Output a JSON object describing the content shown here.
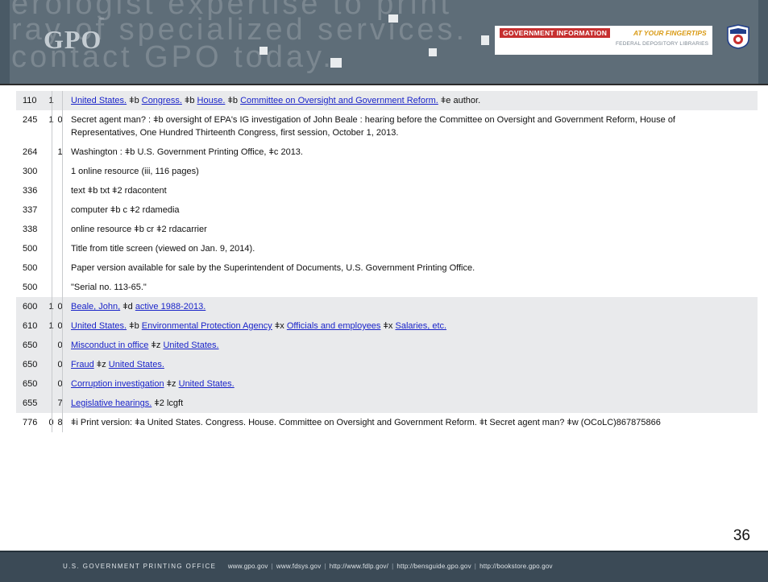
{
  "header": {
    "watermark_lines": [
      "erologist expertise to print",
      "ray of specialized services.",
      "contact GPO today."
    ],
    "logo_text": "GPO",
    "tagline_primary": "GOVERNMENT INFORMATION",
    "tagline_secondary": "AT YOUR FINGERTIPS",
    "tagline_sub": "FEDERAL DEPOSITORY LIBRARIES"
  },
  "record": {
    "rows": [
      {
        "tag": "110",
        "i1": "1",
        "i2": "",
        "shaded": true,
        "parts": [
          {
            "t": "United States.",
            "link": true
          },
          {
            "t": " ǂb "
          },
          {
            "t": "Congress.",
            "link": true
          },
          {
            "t": " ǂb "
          },
          {
            "t": "House.",
            "link": true
          },
          {
            "t": " ǂb "
          },
          {
            "t": "Committee on Oversight and Government Reform.",
            "link": true
          },
          {
            "t": " ǂe author."
          }
        ]
      },
      {
        "tag": "245",
        "i1": "1",
        "i2": "0",
        "shaded": false,
        "parts": [
          {
            "t": "Secret agent man? : ǂb oversight of EPA's IG investigation of John Beale : hearing before the Committee on Oversight and Government Reform, House of Representatives, One Hundred Thirteenth Congress, first session, October 1, 2013."
          }
        ]
      },
      {
        "tag": "264",
        "i1": "",
        "i2": "1",
        "shaded": false,
        "parts": [
          {
            "t": "Washington : ǂb U.S. Government Printing Office, ǂc 2013."
          }
        ]
      },
      {
        "tag": "300",
        "i1": "",
        "i2": "",
        "shaded": false,
        "parts": [
          {
            "t": "1 online resource (iii, 116 pages)"
          }
        ]
      },
      {
        "tag": "336",
        "i1": "",
        "i2": "",
        "shaded": false,
        "parts": [
          {
            "t": "text ǂb txt ǂ2 rdacontent"
          }
        ]
      },
      {
        "tag": "337",
        "i1": "",
        "i2": "",
        "shaded": false,
        "parts": [
          {
            "t": "computer ǂb c ǂ2 rdamedia"
          }
        ]
      },
      {
        "tag": "338",
        "i1": "",
        "i2": "",
        "shaded": false,
        "parts": [
          {
            "t": "online resource ǂb cr ǂ2 rdacarrier"
          }
        ]
      },
      {
        "tag": "500",
        "i1": "",
        "i2": "",
        "shaded": false,
        "parts": [
          {
            "t": "Title from title screen (viewed on Jan. 9, 2014)."
          }
        ]
      },
      {
        "tag": "500",
        "i1": "",
        "i2": "",
        "shaded": false,
        "parts": [
          {
            "t": "Paper version available for sale by the Superintendent of Documents, U.S. Government Printing Office."
          }
        ]
      },
      {
        "tag": "500",
        "i1": "",
        "i2": "",
        "shaded": false,
        "parts": [
          {
            "t": "\"Serial no. 113-65.\""
          }
        ]
      },
      {
        "tag": "600",
        "i1": "1",
        "i2": "0",
        "shaded": true,
        "parts": [
          {
            "t": "Beale, John,",
            "link": true
          },
          {
            "t": " ǂd "
          },
          {
            "t": "active 1988-2013.",
            "link": true
          }
        ]
      },
      {
        "tag": "610",
        "i1": "1",
        "i2": "0",
        "shaded": true,
        "parts": [
          {
            "t": "United States.",
            "link": true
          },
          {
            "t": " ǂb "
          },
          {
            "t": "Environmental Protection Agency",
            "link": true
          },
          {
            "t": " ǂx "
          },
          {
            "t": "Officials and employees",
            "link": true
          },
          {
            "t": " ǂx "
          },
          {
            "t": "Salaries, etc.",
            "link": true
          }
        ]
      },
      {
        "tag": "650",
        "i1": "",
        "i2": "0",
        "shaded": true,
        "parts": [
          {
            "t": "Misconduct in office",
            "link": true
          },
          {
            "t": " ǂz "
          },
          {
            "t": "United States.",
            "link": true
          }
        ]
      },
      {
        "tag": "650",
        "i1": "",
        "i2": "0",
        "shaded": true,
        "parts": [
          {
            "t": "Fraud",
            "link": true
          },
          {
            "t": " ǂz "
          },
          {
            "t": "United States.",
            "link": true
          }
        ]
      },
      {
        "tag": "650",
        "i1": "",
        "i2": "0",
        "shaded": true,
        "parts": [
          {
            "t": "Corruption investigation",
            "link": true
          },
          {
            "t": " ǂz "
          },
          {
            "t": "United States.",
            "link": true
          }
        ]
      },
      {
        "tag": "655",
        "i1": "",
        "i2": "7",
        "shaded": true,
        "parts": [
          {
            "t": "Legislative hearings.",
            "link": true
          },
          {
            "t": " ǂ2 lcgft"
          }
        ]
      },
      {
        "tag": "776",
        "i1": "0",
        "i2": "8",
        "shaded": false,
        "parts": [
          {
            "t": "ǂi Print version: ǂa United States. Congress. House. Committee on Oversight and Government Reform. ǂt Secret agent man? ǂw (OCoLC)867875866"
          }
        ]
      }
    ]
  },
  "page_number": "36",
  "footer": {
    "org": "U.S. GOVERNMENT PRINTING OFFICE",
    "links": [
      "www.gpo.gov",
      "www.fdsys.gov",
      "http://www.fdlp.gov/",
      "http://bensguide.gpo.gov",
      "http://bookstore.gpo.gov"
    ]
  },
  "colors": {
    "header_bg": "#5e6d78",
    "link": "#1a24c9",
    "row_shade": "#e9eaec",
    "footer_bg": "#3b4a56",
    "tag_red": "#c62f2f",
    "tag_yellow": "#d99a14"
  }
}
